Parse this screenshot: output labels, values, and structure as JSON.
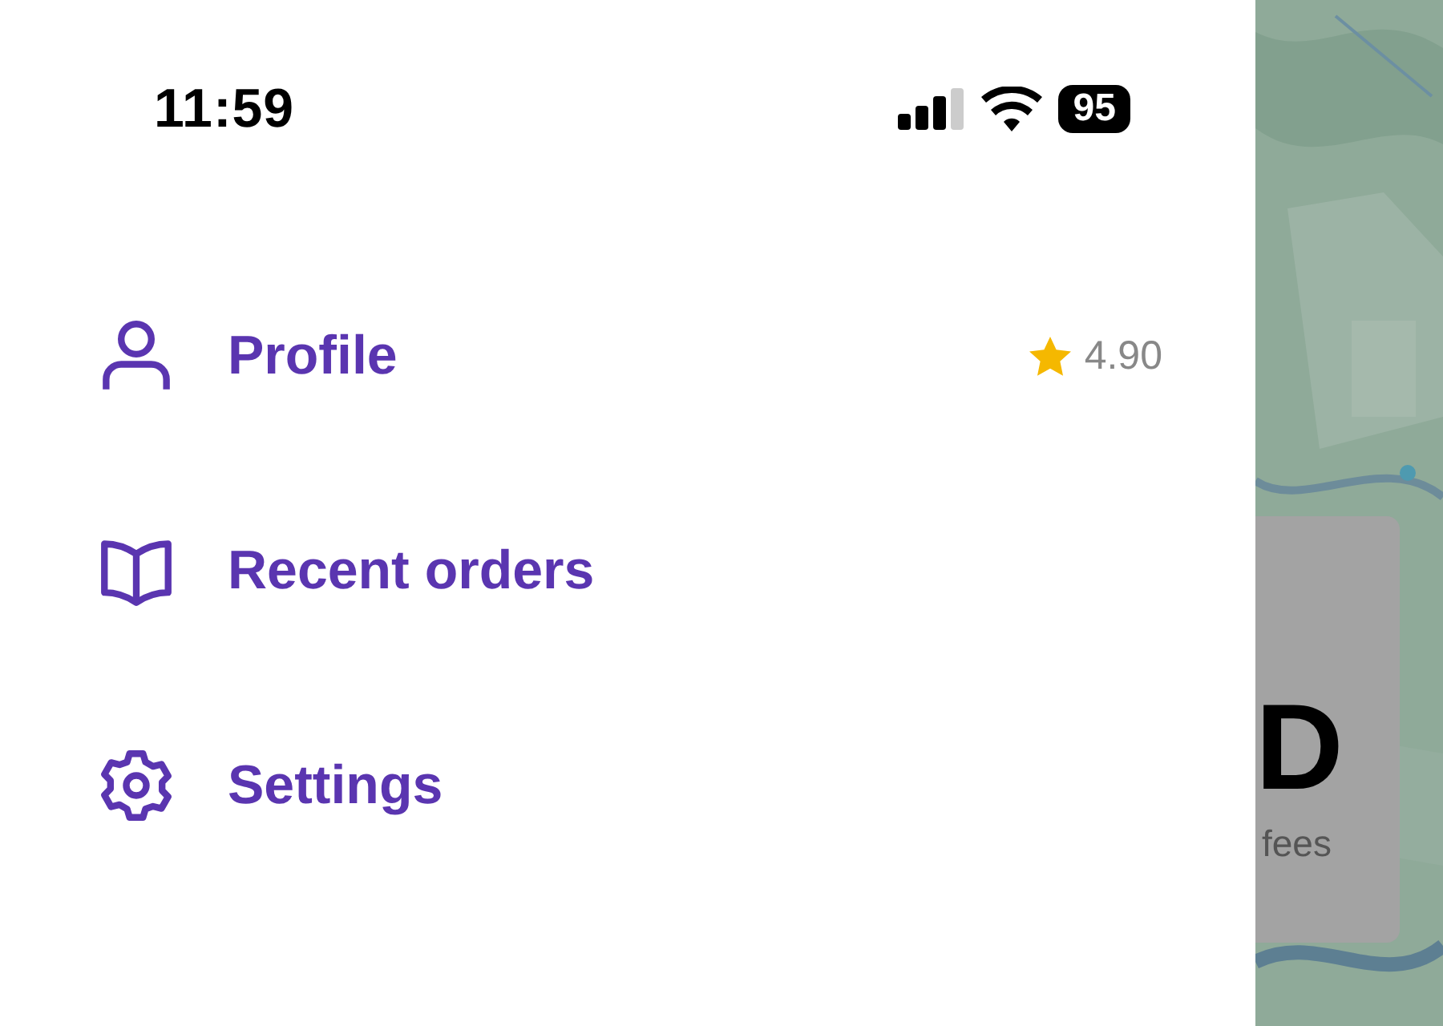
{
  "status_bar": {
    "time": "11:59",
    "battery": "95"
  },
  "menu": [
    {
      "kind": "profile",
      "label": "Profile",
      "rating": "4.90"
    },
    {
      "kind": "orders",
      "label": "Recent orders"
    },
    {
      "kind": "settings",
      "label": "Settings"
    }
  ],
  "background_card": {
    "headline": "D",
    "caption": "fees"
  }
}
